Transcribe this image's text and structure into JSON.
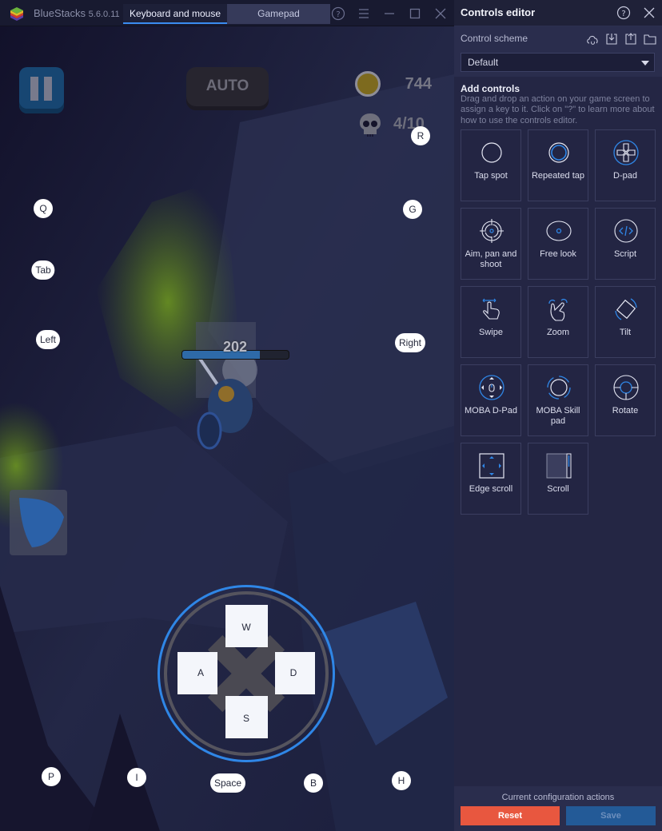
{
  "titlebar": {
    "app_name": "BlueStacks",
    "version": "5.6.0.11",
    "tabs": [
      {
        "label": "Keyboard and mouse",
        "active": true
      },
      {
        "label": "Gamepad",
        "active": false
      }
    ],
    "icons": [
      "help-icon",
      "menu-icon",
      "minimize-icon",
      "maximize-icon",
      "close-icon"
    ]
  },
  "game": {
    "auto_label": "AUTO",
    "coins": "744",
    "kills": "4/10",
    "player_hp": "202",
    "player_hp_fraction": 0.73,
    "key_bindings": [
      {
        "key": "R",
        "name": "key-r"
      },
      {
        "key": "Q",
        "name": "key-q"
      },
      {
        "key": "G",
        "name": "key-g"
      },
      {
        "key": "Tab",
        "name": "key-tab"
      },
      {
        "key": "Left",
        "name": "key-left"
      },
      {
        "key": "Right",
        "name": "key-right"
      },
      {
        "key": "P",
        "name": "key-p"
      },
      {
        "key": "I",
        "name": "key-i"
      },
      {
        "key": "Space",
        "name": "key-space"
      },
      {
        "key": "B",
        "name": "key-b"
      },
      {
        "key": "H",
        "name": "key-h"
      }
    ],
    "dpad": {
      "up": "W",
      "left": "A",
      "right": "D",
      "down": "S"
    }
  },
  "panel": {
    "title": "Controls editor",
    "scheme_label": "Control scheme",
    "scheme_value": "Default",
    "scheme_icons": [
      "cloud-sync-icon",
      "import-icon",
      "export-icon",
      "folder-icon"
    ],
    "add_title": "Add controls",
    "add_desc": "Drag and drop an action on your game screen to assign a key to it. Click on \"?\" to learn more about how to use the controls editor.",
    "controls": [
      {
        "label": "Tap spot",
        "icon": "tap-spot-icon"
      },
      {
        "label": "Repeated tap",
        "icon": "repeated-tap-icon"
      },
      {
        "label": "D-pad",
        "icon": "dpad-icon"
      },
      {
        "label": "Aim, pan and shoot",
        "icon": "crosshair-icon"
      },
      {
        "label": "Free look",
        "icon": "eye-icon"
      },
      {
        "label": "Script",
        "icon": "code-icon"
      },
      {
        "label": "Swipe",
        "icon": "swipe-hand-icon"
      },
      {
        "label": "Zoom",
        "icon": "pinch-zoom-icon"
      },
      {
        "label": "Tilt",
        "icon": "tilt-icon"
      },
      {
        "label": "MOBA D-Pad",
        "icon": "moba-dpad-icon"
      },
      {
        "label": "MOBA Skill pad",
        "icon": "moba-skill-icon"
      },
      {
        "label": "Rotate",
        "icon": "rotate-icon"
      },
      {
        "label": "Edge scroll",
        "icon": "edge-scroll-icon"
      },
      {
        "label": "Scroll",
        "icon": "scroll-icon"
      }
    ],
    "footer_label": "Current configuration actions",
    "reset_label": "Reset",
    "save_label": "Save"
  },
  "colors": {
    "accent": "#2f86e6",
    "reset": "#e8573f",
    "save": "#235a97",
    "panel_bg": "#242644"
  }
}
